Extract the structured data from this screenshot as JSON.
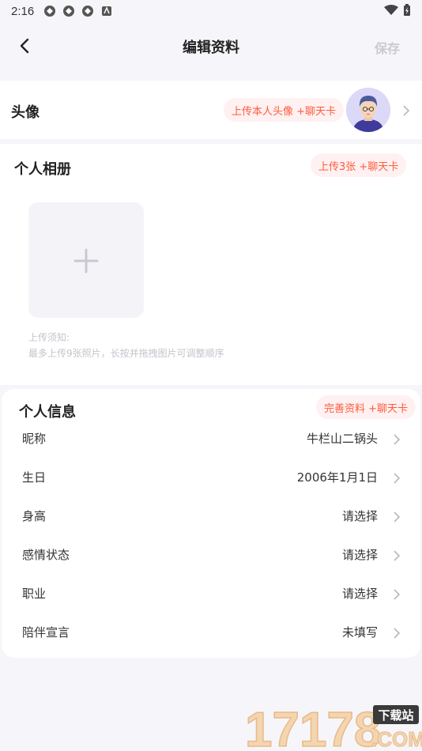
{
  "status_bar": {
    "time": "2:16"
  },
  "nav": {
    "title": "编辑资料",
    "save_label": "保存"
  },
  "avatar_section": {
    "title": "头像",
    "badge": "上传本人头像 +聊天卡"
  },
  "album_section": {
    "title": "个人相册",
    "badge": "上传3张 +聊天卡",
    "note_title": "上传须知:",
    "note_body": "最多上传9张照片，长按并拖拽图片可调整顺序"
  },
  "info_section": {
    "title": "个人信息",
    "badge": "完善资料 +聊天卡",
    "rows": [
      {
        "label": "昵称",
        "value": "牛栏山二锅头"
      },
      {
        "label": "生日",
        "value": "2006年1月1日"
      },
      {
        "label": "身高",
        "value": "请选择"
      },
      {
        "label": "感情状态",
        "value": "请选择"
      },
      {
        "label": "职业",
        "value": "请选择"
      },
      {
        "label": "陪伴宣言",
        "value": "未填写"
      }
    ]
  },
  "watermark": {
    "site": "17178",
    "tag": "下载站",
    "domain": ".COM"
  },
  "colors": {
    "accent": "#ff5a3c",
    "badge_bg": "#fff1f1",
    "page_bg": "#f6f6fa"
  }
}
